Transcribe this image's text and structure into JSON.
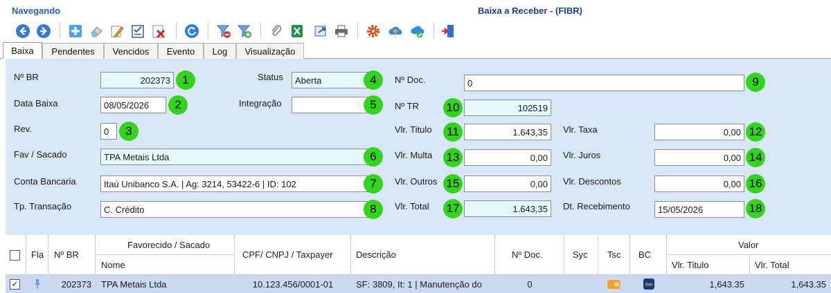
{
  "window": {
    "mode": "Navegando",
    "title": "Baixa a Receber - (FIBR)"
  },
  "toolbar": {
    "icons": [
      "back-icon",
      "forward-icon",
      "new-icon",
      "erase-icon",
      "edit-icon",
      "checklist-icon",
      "delete-icon",
      "refresh-icon",
      "filter-remove-icon",
      "filter-add-icon",
      "attach-icon",
      "excel-icon",
      "export-icon",
      "print-icon",
      "settings-icon",
      "cloud-upload-icon",
      "cloud-sync-icon",
      "exit-icon"
    ]
  },
  "tabs": [
    "Baixa",
    "Pendentes",
    "Vencidos",
    "Evento",
    "Log",
    "Visualização"
  ],
  "form": {
    "nr_br": {
      "label": "Nº BR",
      "value": "202373",
      "badge": "1"
    },
    "data_baixa": {
      "label": "Data Baixa",
      "value": "08/05/2026",
      "badge": "2"
    },
    "rev": {
      "label": "Rev.",
      "value": "0",
      "badge": "3"
    },
    "status": {
      "label": "Status",
      "value": "Aberta",
      "badge": "4"
    },
    "integracao": {
      "label": "Integração",
      "value": "",
      "badge": "5"
    },
    "fav_sacado": {
      "label": "Fav / Sacado",
      "value": "TPA Metais Ltda",
      "badge": "6"
    },
    "conta_bancaria": {
      "label": "Conta Bancaria",
      "value": "Itaú Unibanco S.A. | Ag: 3214, 53422-6 | ID: 102",
      "badge": "7"
    },
    "tp_transacao": {
      "label": "Tp. Transação",
      "value": "C. Crédito",
      "badge": "8"
    },
    "nr_doc": {
      "label": "Nº Doc.",
      "value": "0",
      "badge": "9"
    },
    "nr_tr": {
      "label": "Nº TR",
      "value": "102519",
      "badge": "10"
    },
    "vlr_titulo": {
      "label": "Vlr. Titulo",
      "value": "1.643,35",
      "badge": "11"
    },
    "vlr_taxa": {
      "label": "Vlr. Taxa",
      "value": "0,00",
      "badge": "12"
    },
    "vlr_multa": {
      "label": "Vlr. Multa",
      "value": "0,00",
      "badge": "13"
    },
    "vlr_juros": {
      "label": "Vlr. Juros",
      "value": "0,00",
      "badge": "14"
    },
    "vlr_outros": {
      "label": "Vlr. Outros",
      "value": "0,00",
      "badge": "15"
    },
    "vlr_descontos": {
      "label": "Vlr. Descontos",
      "value": "0,00",
      "badge": "16"
    },
    "vlr_total": {
      "label": "Vlr. Total",
      "value": "1.643,35",
      "badge": "17"
    },
    "dt_recebimento": {
      "label": "Dt. Recebimento",
      "value": "15/05/2026",
      "badge": "18"
    }
  },
  "grid": {
    "headers": {
      "fla": "Fla",
      "nr_br": "Nº BR",
      "favorecido": "Favorecido / Sacado",
      "nome": "Nome",
      "cpf": "CPF/ CNPJ / Taxpayer",
      "descricao": "Descrição",
      "nr_doc": "Nº Doc.",
      "syc": "Syc",
      "tsc": "Tsc",
      "bc": "BC",
      "valor": "Valor",
      "vlr_titulo": "Vlr. Titulo",
      "vlr_total": "Vlr. Total"
    },
    "rows": [
      {
        "checked": true,
        "nr_br": "202373",
        "nome": "TPA Metais Ltda",
        "cpf": "10.123.456/0001-01",
        "descricao": "SF: 3809, It: 1 | Manutenção do",
        "nr_doc": "0",
        "bank_logo": "itaú",
        "vlr_titulo": "1,643.35",
        "vlr_total": "1,643.35"
      }
    ]
  }
}
